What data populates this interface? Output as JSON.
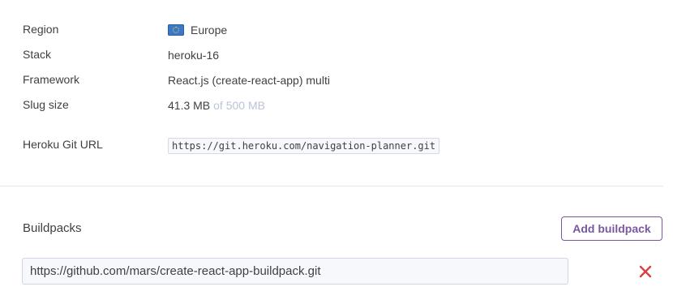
{
  "settings": {
    "rows": [
      {
        "label": "Region",
        "value": "Europe",
        "icon": "eu-flag-icon"
      },
      {
        "label": "Stack",
        "value": "heroku-16"
      },
      {
        "label": "Framework",
        "value": "React.js (create-react-app) multi"
      },
      {
        "label": "Slug size",
        "value": "41.3 MB",
        "suffix": "of 500 MB"
      },
      {
        "label": "Heroku Git URL",
        "value": "https://git.heroku.com/navigation-planner.git"
      }
    ]
  },
  "buildpacks": {
    "title": "Buildpacks",
    "add_label": "Add buildpack",
    "items": [
      {
        "url": "https://github.com/mars/create-react-app-buildpack.git"
      }
    ]
  },
  "colors": {
    "accent": "#79589f",
    "remove": "#d64242",
    "muted": "#b9c4d6"
  }
}
